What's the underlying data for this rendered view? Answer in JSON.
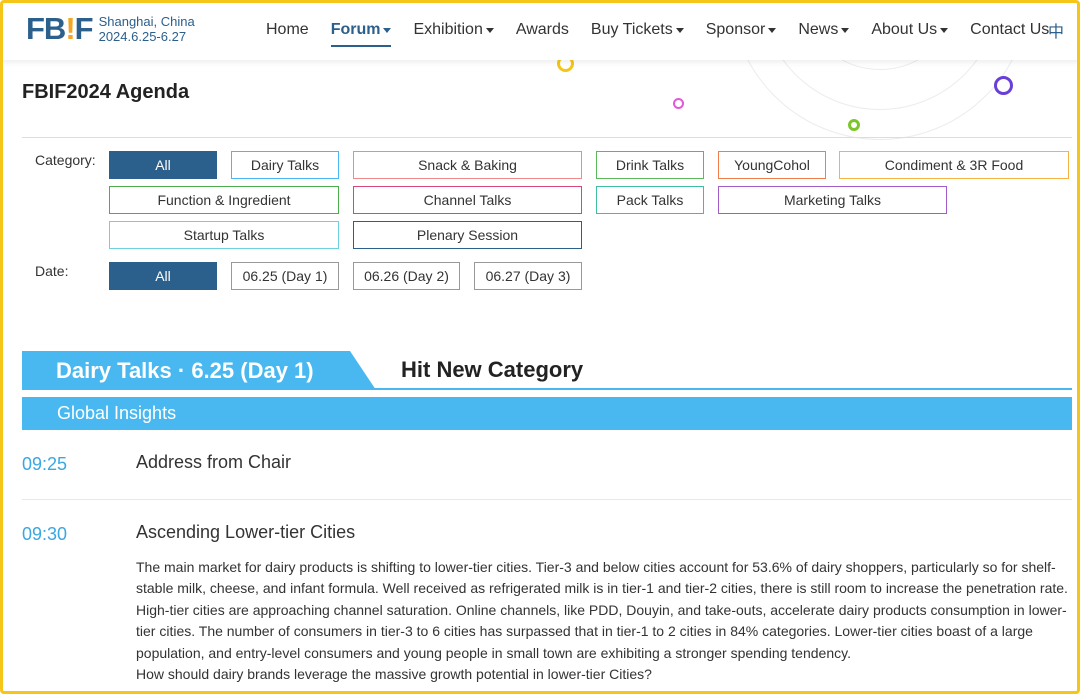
{
  "header": {
    "logo_mark_a": "FB",
    "logo_mark_bang": "!",
    "logo_mark_b": "F",
    "logo_city": "Shanghai, China",
    "logo_dates": "2024.6.25-6.27",
    "nav": [
      {
        "label": "Home",
        "dropdown": false,
        "active": false
      },
      {
        "label": "Forum",
        "dropdown": true,
        "active": true
      },
      {
        "label": "Exhibition",
        "dropdown": true,
        "active": false
      },
      {
        "label": "Awards",
        "dropdown": false,
        "active": false
      },
      {
        "label": "Buy Tickets",
        "dropdown": true,
        "active": false
      },
      {
        "label": "Sponsor",
        "dropdown": true,
        "active": false
      },
      {
        "label": "News",
        "dropdown": true,
        "active": false
      },
      {
        "label": "About Us",
        "dropdown": true,
        "active": false
      },
      {
        "label": "Contact Us",
        "dropdown": false,
        "active": false
      }
    ],
    "lang_toggle": "中"
  },
  "page_title": "FBIF2024 Agenda",
  "filters": {
    "category_label": "Category:",
    "categories": [
      {
        "label": "All",
        "color": "#2b5f8c",
        "active": true
      },
      {
        "label": "Dairy Talks",
        "color": "#4ab8f0",
        "active": false
      },
      {
        "label": "Snack & Baking",
        "color": "#f08a8a",
        "active": false
      },
      {
        "label": "Drink Talks",
        "color": "#5cb85c",
        "active": false
      },
      {
        "label": "YoungCohol",
        "color": "#f07d4a",
        "active": false
      },
      {
        "label": "Condiment & 3R Food",
        "color": "#f5b342",
        "active": false
      },
      {
        "label": "Function & Ingredient",
        "color": "#4cae4c",
        "active": false
      },
      {
        "label": "Channel Talks",
        "color": "#d9477a",
        "active": false
      },
      {
        "label": "Pack Talks",
        "color": "#3fbfa0",
        "active": false
      },
      {
        "label": "Marketing Talks",
        "color": "#a45cc8",
        "active": false
      },
      {
        "label": "Startup Talks",
        "color": "#6fd0e0",
        "active": false
      },
      {
        "label": "Plenary Session",
        "color": "#2b5f8c",
        "active": false
      }
    ],
    "date_label": "Date:",
    "dates": [
      {
        "label": "All",
        "active": true
      },
      {
        "label": "06.25 (Day 1)",
        "active": false
      },
      {
        "label": "06.26 (Day 2)",
        "active": false
      },
      {
        "label": "06.27 (Day 3)",
        "active": false
      }
    ]
  },
  "session": {
    "tab_label": "Dairy Talks · 6.25 (Day 1)",
    "title": "Hit New Category",
    "subsession": "Global Insights"
  },
  "agenda": [
    {
      "time": "09:25",
      "topic": "Address from Chair"
    },
    {
      "time": "09:30",
      "topic": "Ascending Lower-tier Cities",
      "description": "The main market for dairy products is shifting to lower-tier cities. Tier-3 and below cities account for 53.6% of dairy shoppers, particularly so for shelf-stable milk, cheese, and infant formula. Well received as refrigerated milk is in tier-1 and tier-2 cities, there is still room to increase the penetration rate. High-tier cities are approaching channel saturation. Online channels, like PDD, Douyin, and take-outs, accelerate dairy products consumption in lower-tier cities. The number of consumers in tier-3 to 6 cities has surpassed that in tier-1 to 2 cities in 84% categories. Lower-tier cities boast of a large population, and entry-level consumers and young people in small town are exhibiting a stronger spending tendency.",
      "question": "How should dairy brands leverage the massive growth potential in lower-tier Cities?"
    }
  ],
  "colors": {
    "brand_blue": "#2b5f8c",
    "accent_sky": "#4ab8f0",
    "logo_orange": "#f5a623",
    "time_blue": "#3aa7e0"
  }
}
